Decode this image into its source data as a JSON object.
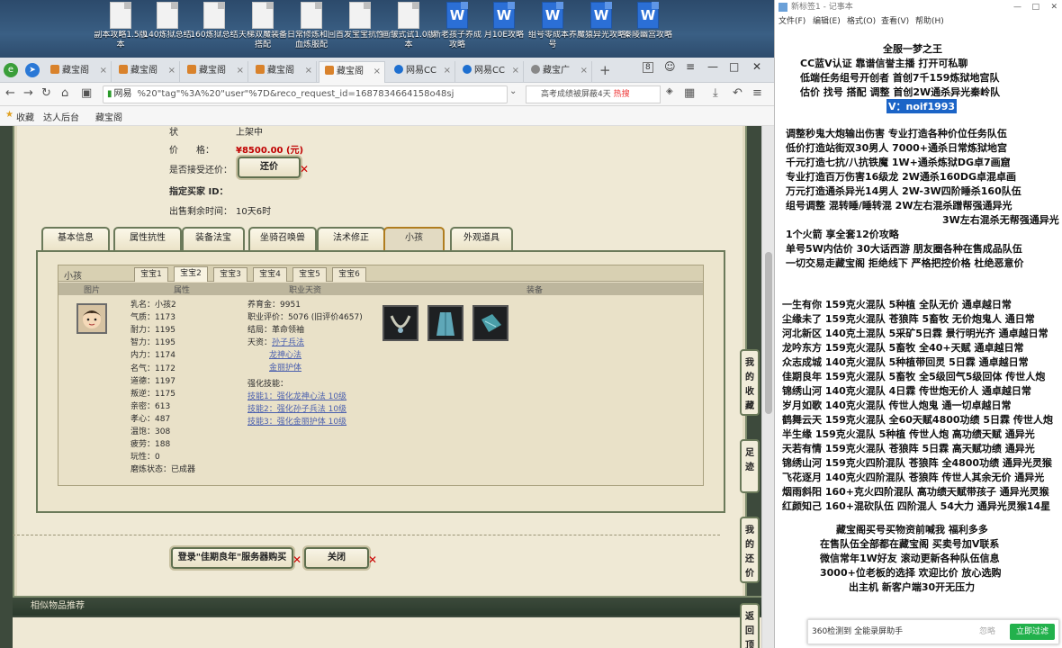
{
  "desktop": {
    "icons": [
      {
        "label": "副本攻略1.5版本",
        "type": "doc"
      },
      {
        "label": "140炼狱总结",
        "type": "doc"
      },
      {
        "label": "160炼狱总结",
        "type": "doc"
      },
      {
        "label": "天梯双魔装备搭配",
        "type": "doc"
      },
      {
        "label": "日常修炼和回血炼服配",
        "type": "doc"
      },
      {
        "label": "首发宝宝抗性",
        "type": "doc"
      },
      {
        "label": "画皱式试1.0版本",
        "type": "doc"
      },
      {
        "label": "新老孩子养成攻略",
        "type": "word"
      },
      {
        "label": "月10E攻略",
        "type": "word"
      },
      {
        "label": "组号零成本养号",
        "type": "word"
      },
      {
        "label": "魔猿异光攻略",
        "type": "word"
      },
      {
        "label": "秦陵幽宫攻略",
        "type": "word"
      }
    ]
  },
  "browser": {
    "tabs": [
      {
        "label": "藏宝阁",
        "active": false
      },
      {
        "label": "藏宝阁",
        "active": false
      },
      {
        "label": "藏宝阁",
        "active": false
      },
      {
        "label": "藏宝阁",
        "active": false
      },
      {
        "label": "藏宝阁",
        "active": true
      },
      {
        "label": "网易CC",
        "active": false
      },
      {
        "label": "网易CC",
        "active": false
      },
      {
        "label": "藏宝广",
        "active": false
      }
    ],
    "tab_count": "8",
    "url": "%20\"tag\"%3A%20\"user\"%7D&reco_request_id=1687834664158o48sj",
    "site_label": "网易",
    "search_text": "高考成绩被屏蔽4天",
    "search_badge": "热搜",
    "bookmarks": [
      "收藏",
      "达人后台",
      "藏宝阁"
    ]
  },
  "item": {
    "state_label": "状",
    "state_value": "上架中",
    "price_label": "价　　格：",
    "price_value": "¥8500.00 (元)",
    "bargain_label": "是否接受还价：",
    "bargain_button": "还价",
    "buyer_label": "指定买家 ID：",
    "remain_label": "出售剩余时间：",
    "remain_value": "10天6时"
  },
  "main_tabs": [
    "基本信息",
    "属性抗性",
    "装备法宝",
    "坐骑召唤兽",
    "法术修正",
    "小孩",
    "外观道具"
  ],
  "active_main_tab": "小孩",
  "child": {
    "title": "小孩",
    "sub_tabs": [
      "宝宝1",
      "宝宝2",
      "宝宝3",
      "宝宝4",
      "宝宝5",
      "宝宝6"
    ],
    "active_sub_tab": "宝宝2",
    "columns": [
      "图片",
      "属性",
      "职业天资",
      "装备"
    ],
    "stats": [
      {
        "k": "乳名：",
        "v": "小孩2"
      },
      {
        "k": "气质：",
        "v": "1173"
      },
      {
        "k": "耐力：",
        "v": "1195"
      },
      {
        "k": "智力：",
        "v": "1195"
      },
      {
        "k": "内力：",
        "v": "1174"
      },
      {
        "k": "名气：",
        "v": "1172"
      },
      {
        "k": "道德：",
        "v": "1197"
      },
      {
        "k": "叛逆：",
        "v": "1175"
      },
      {
        "k": "亲密：",
        "v": "613"
      },
      {
        "k": "孝心：",
        "v": "487"
      },
      {
        "k": "温饱：",
        "v": "308"
      },
      {
        "k": "疲劳：",
        "v": "188"
      },
      {
        "k": "玩性：",
        "v": "0"
      },
      {
        "k": "磨炼状态：",
        "v": "已成器"
      }
    ],
    "career": {
      "yang_label": "养育金：",
      "yang_value": "9951",
      "eval_label": "职业评价：",
      "eval_value": "5076 (旧评价4657)",
      "end_label": "结局：",
      "end_value": "革命领袖",
      "talent_label": "天资：",
      "talents": [
        "孙子兵法",
        "龙神心法",
        "金丽护体"
      ],
      "skill_label": "强化技能：",
      "skills": [
        "技能1：强化龙神心法 10级",
        "技能2：强化孙子兵法 10级",
        "技能3：强化金丽护体 10级"
      ]
    }
  },
  "actions": {
    "login_buy": "登录\"佳期良年\"服务器购买",
    "close": "关闭"
  },
  "similar_title": "相似物品推荐",
  "side_buttons": [
    "我的收藏",
    "足迹",
    "我的还价",
    "返回顶部"
  ],
  "notepad": {
    "title": "新标签1 - 记事本",
    "menu": [
      "文件(F)",
      "编辑(E)",
      "格式(O)",
      "查看(V)",
      "帮助(H)"
    ],
    "lines": [
      "全服一梦之王",
      "CC蓝V认证  靠谱信誉主播  打开可私聊",
      "低端任务组号开创者            首创7千159炼狱地宫队",
      "估价 找号 搭配 调整            首创2W通杀异光秦岭队",
      "V：noif1993",
      "调整秒鬼大炮输出伤害           专业打造各种价位任务队伍",
      "低价打造站街双30男人              7000+通杀日常炼狱地宫",
      "千元打造七抗/八抗铁魔          1W+通杀炼狱DG卓7画窟",
      "专业打造百万伤害16级龙        2W通杀160DG卓混卓画",
      "万元打造通杀异光14男人       2W-3W四阶睡杀160队伍",
      "组号调整 混转睡/睡转混         2W左右混杀蹭帮强通异光",
      "3W左右混杀无帮强通异光",
      "1个火箭 享全套12价攻略",
      "单号5W内估价 30大话西游         朋友圈各种在售成品队伍",
      "一切交易走藏宝阁 拒绝线下     严格把控价格 杜绝恶意价",
      "一生有你 159克火混队 5种植 全队无价 通卓越日常",
      "尘缘未了 159克火混队 苍狼阵 5畜牧 无价炮鬼人 通日常",
      "河北新区 140克土混队 5采矿5日霖 景行明光齐 通卓越日常",
      "龙吟东方 159克火混队 5畜牧 全40+天赋 通卓越日常",
      "众志成城 140克火混队 5种植带回灵 5日霖 通卓越日常",
      "佳期良年 159克火混队 5畜牧 全5级回气5级回体 传世人炮",
      "锦绣山河 140克火混队 4日霖 传世炮无价人 通卓越日常",
      "岁月如歌 140克火混队 传世人炮鬼 通一切卓越日常",
      "鹤舞云天 159克火混队 全60天赋4800功绩 5日霖 传世人炮",
      "半生缘    159克火混队 5种植 传世人炮 高功绩天赋 通异光",
      "天若有情 159克火混队 苍狼阵 5日霖 高天赋功绩 通异光",
      "锦绣山河 159克火四阶混队 苍狼阵 全4800功绩 通异光灵猴",
      "飞花逐月 140克火四阶混队 苍狼阵 传世人其余无价 通异光",
      "烟雨斜阳 160+克火四阶混队 高功绩天赋带孩子 通异光灵猴",
      "红颜知己 160+混砍队伍 四阶混人 54大力 通异光灵猴14星",
      "藏宝阁买号买物资前喊我 福利多多",
      "在售队伍全部都在藏宝阁 买卖号加V联系",
      "微信常年1W好友 滚动更新各种队伍信息",
      "3000+位老板的选择 欢迎比价 放心选购",
      "出主机 新客户端30开无压力"
    ],
    "toast_text": "360检测到",
    "toast_bold": "全能录屏助手",
    "toast_close": "忽略",
    "toast_button": "立即过滤"
  }
}
